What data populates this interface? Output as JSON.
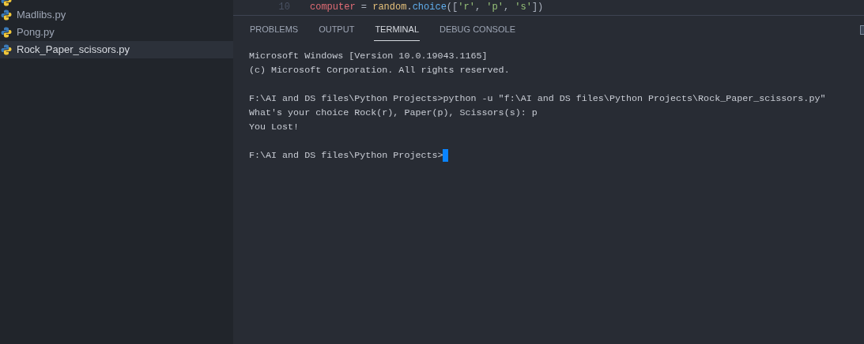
{
  "sidebar": {
    "files": [
      {
        "name": "Madlibs.py",
        "selected": false
      },
      {
        "name": "Pong.py",
        "selected": false
      },
      {
        "name": "Rock_Paper_scissors.py",
        "selected": true
      }
    ]
  },
  "editor": {
    "line_number": "10",
    "tokens": [
      {
        "kind": "variable",
        "text": "computer"
      },
      {
        "kind": "operator",
        "text": " = "
      },
      {
        "kind": "module",
        "text": "random"
      },
      {
        "kind": "punctuation",
        "text": "."
      },
      {
        "kind": "function",
        "text": "choice"
      },
      {
        "kind": "punctuation",
        "text": "(["
      },
      {
        "kind": "string",
        "text": "'r'"
      },
      {
        "kind": "punctuation",
        "text": ", "
      },
      {
        "kind": "string",
        "text": "'p'"
      },
      {
        "kind": "punctuation",
        "text": ", "
      },
      {
        "kind": "string",
        "text": "'s'"
      },
      {
        "kind": "punctuation",
        "text": "])"
      }
    ]
  },
  "panel": {
    "tabs": [
      {
        "label": "PROBLEMS",
        "selected": false
      },
      {
        "label": "OUTPUT",
        "selected": false
      },
      {
        "label": "TERMINAL",
        "selected": true
      },
      {
        "label": "DEBUG CONSOLE",
        "selected": false
      }
    ],
    "terminal": {
      "blocks": [
        [
          "Microsoft Windows [Version 10.0.19043.1165]",
          "(c) Microsoft Corporation. All rights reserved."
        ],
        [
          "F:\\AI and DS files\\Python Projects>python -u \"f:\\AI and DS files\\Python Projects\\Rock_Paper_scissors.py\"",
          "What's your choice Rock(r), Paper(p), Scissors(s): p",
          "You Lost!"
        ]
      ],
      "prompt": "F:\\AI and DS files\\Python Projects>"
    }
  }
}
